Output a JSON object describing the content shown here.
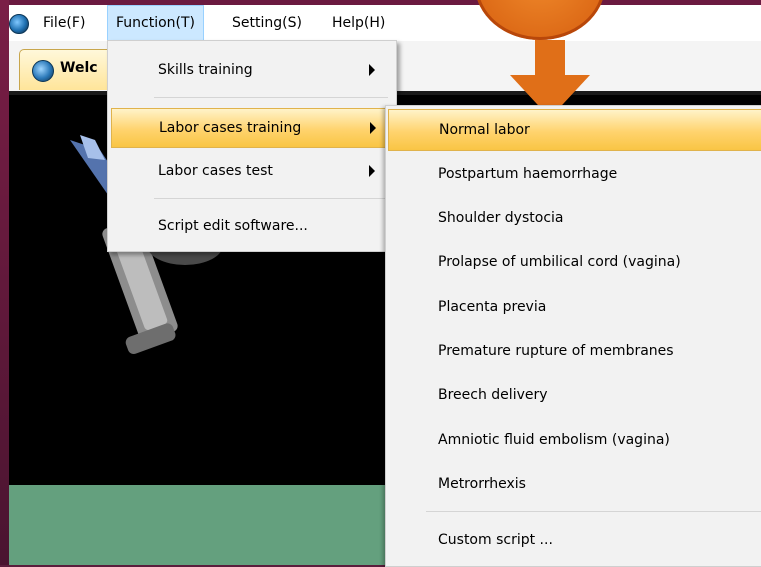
{
  "menubar": {
    "items": [
      "File(F)",
      "Function(T)",
      "Setting(S)",
      "Help(H)"
    ]
  },
  "tab": {
    "label": "Welc"
  },
  "function_menu": {
    "items": [
      {
        "label": "Skills training",
        "has_submenu": true
      },
      {
        "label": "Labor cases training",
        "has_submenu": true
      },
      {
        "label": "Labor cases test",
        "has_submenu": true
      },
      {
        "label": "Script edit software...",
        "has_submenu": false
      }
    ]
  },
  "labor_cases_submenu": {
    "items": [
      "Normal labor",
      "Postpartum haemorrhage",
      "Shoulder dystocia",
      "Prolapse of umbilical cord (vagina)",
      "Placenta previa",
      "Premature rupture of membranes",
      "Breech delivery",
      "Amniotic fluid embolism (vagina)",
      "Metrorrhexis",
      "Custom script ..."
    ]
  },
  "colors": {
    "highlight": "#ffd36d",
    "active_menu": "#cce8ff",
    "callout_orange": "#e06f18",
    "bottom_panel": "#64a07e"
  }
}
